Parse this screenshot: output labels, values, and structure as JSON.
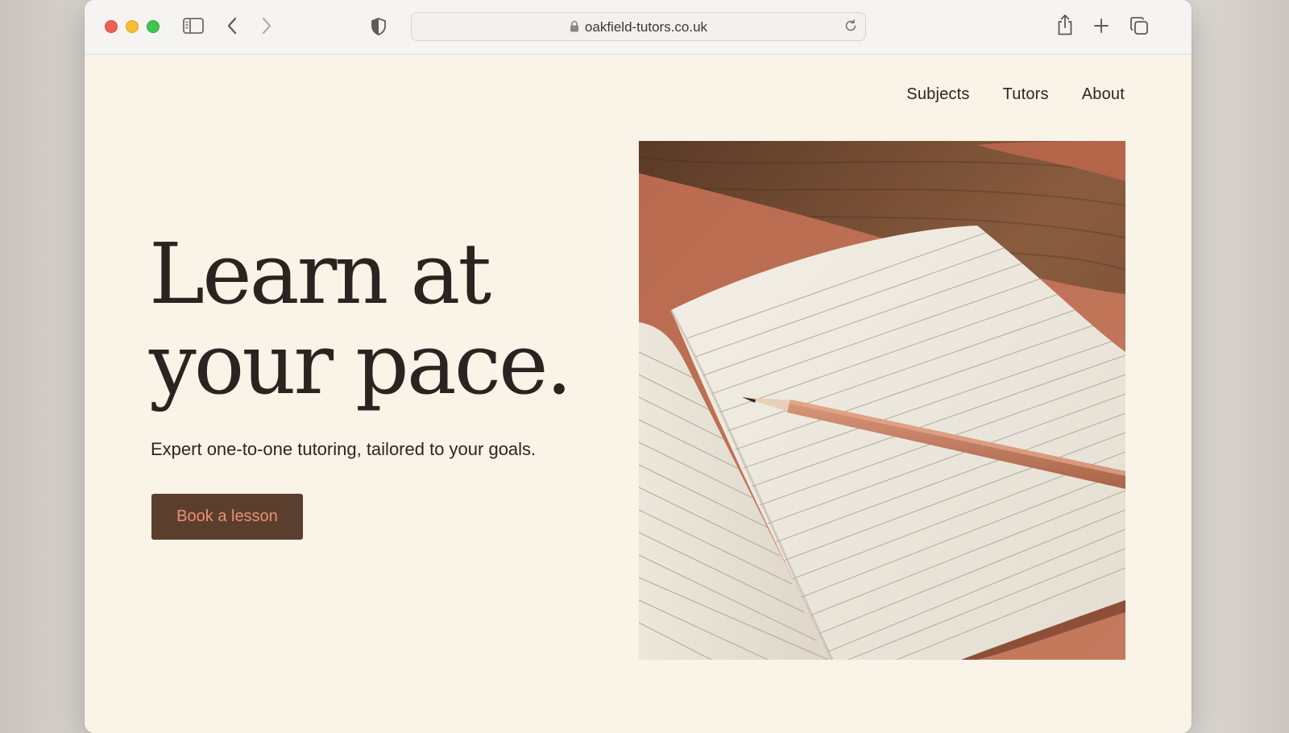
{
  "browser": {
    "url": "oakfield-tutors.co.uk"
  },
  "nav": {
    "items": [
      "Subjects",
      "Tutors",
      "About"
    ]
  },
  "hero": {
    "headline_line1": "Learn at",
    "headline_line2": "your pace.",
    "subtitle": "Expert one-to-one tutoring, tailored to your goals.",
    "cta_label": "Book a lesson"
  },
  "colors": {
    "page_background": "#faf3e8",
    "cta_background": "#5c3e2f",
    "cta_text": "#e9916e",
    "text": "#2a2420"
  },
  "icons": {
    "toolbar": [
      "sidebar-icon",
      "back-icon",
      "forward-icon",
      "shield-icon",
      "lock-icon",
      "reload-icon",
      "share-icon",
      "new-tab-icon",
      "tabs-overview-icon"
    ]
  }
}
